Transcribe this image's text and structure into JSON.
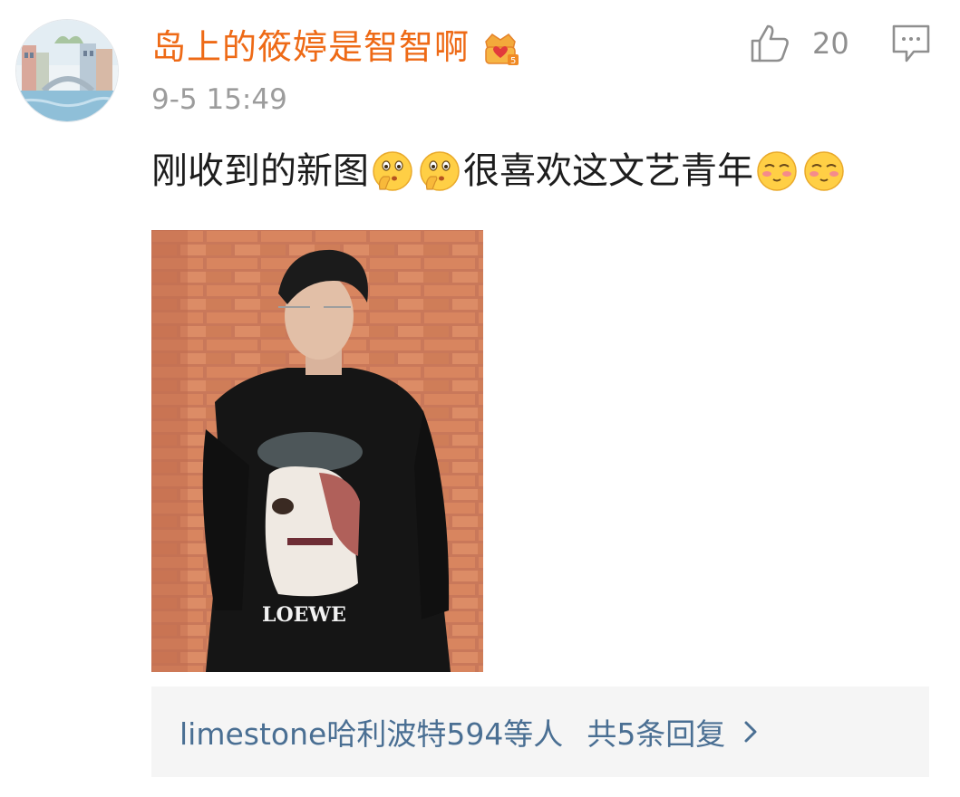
{
  "comment": {
    "username": "岛上的筱婷是智智啊",
    "badge_icon": "vip-crown-badge",
    "timestamp": "9-5 15:49",
    "like_count": "20",
    "text_part1": "刚收到的新图",
    "text_part2": "很喜欢这文艺青年",
    "emojis_group1": [
      "shushing-face-emoji",
      "shushing-face-emoji"
    ],
    "emojis_group2": [
      "shy-face-emoji",
      "shy-face-emoji"
    ],
    "photo_shirt_text": "LOEWE"
  },
  "replies": {
    "replier": "limestone哈利波特594等人",
    "count_label": "共5条回复"
  },
  "colors": {
    "username": "#ee6a16",
    "link": "#4a6f93",
    "timestamp": "#9c9c9c",
    "reply_bg": "#f5f5f5"
  }
}
